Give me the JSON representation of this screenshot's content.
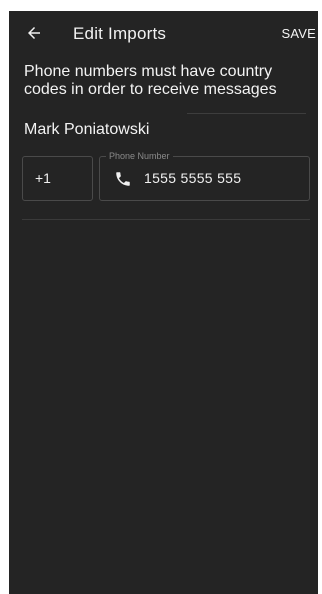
{
  "header": {
    "back_icon": "arrow-left-icon",
    "title": "Edit Imports",
    "save_label": "SAVE"
  },
  "notice": {
    "text": "Phone numbers must have country codes in order to receive messages"
  },
  "contact": {
    "name": "Mark Poniatowski",
    "country_code": "+1",
    "phone_label": "Phone Number",
    "phone_icon": "phone-icon",
    "phone_value": "1555 5555 555"
  },
  "colors": {
    "background": "#242424",
    "text": "#f3f3f3",
    "border": "#4a4a4a",
    "label": "#8a8a8a"
  }
}
